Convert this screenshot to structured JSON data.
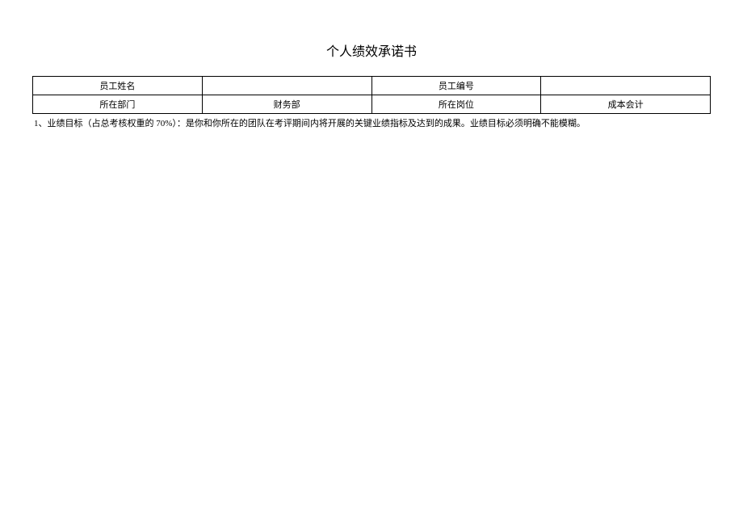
{
  "title": "个人绩效承诺书",
  "table": {
    "row1": {
      "label1": "员工姓名",
      "value1": "",
      "label2": "员工编号",
      "value2": ""
    },
    "row2": {
      "label1": "所在部门",
      "value1": "财务部",
      "label2": "所在岗位",
      "value2": "成本会计"
    }
  },
  "note": "1、业绩目标（占总考核权重的 70%）：是你和你所在的团队在考评期间内将开展的关键业绩指标及达到的成果。业绩目标必须明确不能模糊。"
}
